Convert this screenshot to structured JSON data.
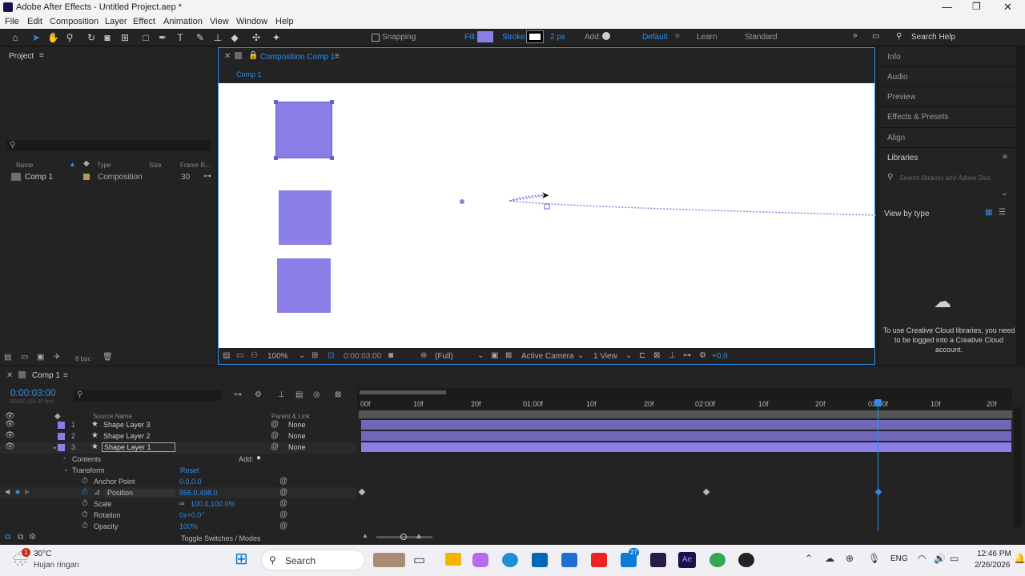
{
  "window": {
    "title": "Adobe After Effects - Untitled Project.aep *"
  },
  "menu": [
    "File",
    "Edit",
    "Composition",
    "Layer",
    "Effect",
    "Animation",
    "View",
    "Window",
    "Help"
  ],
  "toolbar": {
    "snapping": "Snapping",
    "fill": "Fill:",
    "stroke": "Stroke:",
    "stroke_width": "2 px",
    "add": "Add:",
    "workspace_default": "Default",
    "workspace_learn": "Learn",
    "workspace_standard": "Standard",
    "search_help": "Search Help",
    "fill_color": "#8a7fe6"
  },
  "project": {
    "title": "Project",
    "cols": [
      "Name",
      "Type",
      "Size",
      "Frame R..."
    ],
    "item": {
      "name": "Comp 1",
      "type": "Composition",
      "frame_rate": "30"
    },
    "bpc": "8 bpc"
  },
  "composition": {
    "tab": "Composition Comp 1",
    "subtab": "Comp 1",
    "zoom": "100%",
    "timecode": "0:00:03:00",
    "resolution": "(Full)",
    "camera": "Active Camera",
    "views": "1 View",
    "exposure": "+0.0"
  },
  "right_panels": {
    "items": [
      "Info",
      "Audio",
      "Preview",
      "Effects & Presets",
      "Align",
      "Libraries"
    ],
    "search_placeholder": "Search libraries and Adobe Stoc",
    "view_by": "View by type",
    "login_msg": "To use Creative Cloud libraries, you need to be logged into a Creative Cloud account."
  },
  "timeline": {
    "tab": "Comp 1",
    "timecode": "0:00:03:00",
    "fps": "00090 (30.00 fps)",
    "ruler": [
      "00f",
      "10f",
      "20f",
      "01:00f",
      "10f",
      "20f",
      "02:00f",
      "10f",
      "20f",
      "03:00f",
      "10f",
      "20f"
    ],
    "col_source": "Source Name",
    "col_parent": "Parent & Link",
    "layers": [
      {
        "num": "1",
        "name": "Shape Layer 3",
        "parent": "None"
      },
      {
        "num": "2",
        "name": "Shape Layer 2",
        "parent": "None"
      },
      {
        "num": "3",
        "name": "Shape Layer 1",
        "parent": "None"
      }
    ],
    "contents": "Contents",
    "add": "Add:",
    "transform": "Transform",
    "reset": "Reset",
    "props": [
      {
        "name": "Anchor Point",
        "value": "0.0,0.0"
      },
      {
        "name": "Position",
        "value": "956.0,498.0"
      },
      {
        "name": "Scale",
        "value": "100.0,100.0%"
      },
      {
        "name": "Rotation",
        "value": "0x+0.0°"
      },
      {
        "name": "Opacity",
        "value": "100%"
      }
    ],
    "toggle": "Toggle Switches / Modes"
  },
  "taskbar": {
    "temp": "30°C",
    "weather": "Hujan ringan",
    "search": "Search",
    "lang": "ENG",
    "time": "12:46 PM",
    "date": "2/26/2026",
    "badge": "27",
    "notif": "1"
  }
}
